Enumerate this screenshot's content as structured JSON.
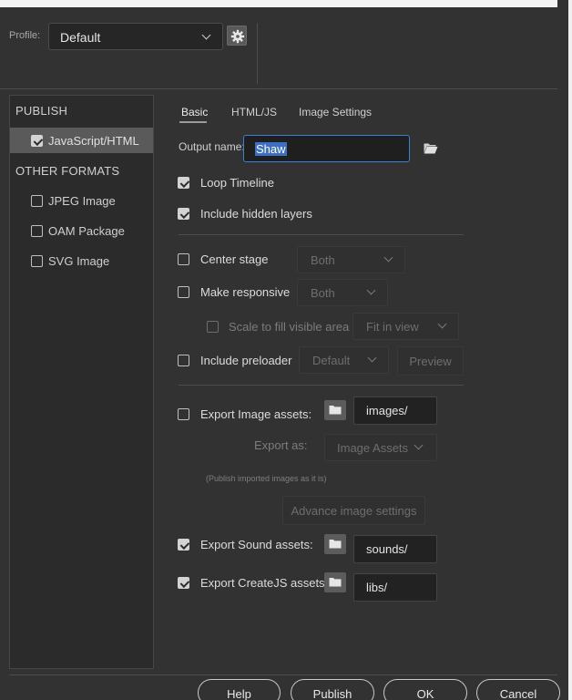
{
  "header": {
    "profile_label": "Profile:",
    "profile_value": "Default"
  },
  "sidebar": {
    "publish_heading": "PUBLISH",
    "publish_items": [
      {
        "label": "JavaScript/HTML",
        "checked": true,
        "selected": true
      }
    ],
    "other_heading": "OTHER FORMATS",
    "other_items": [
      {
        "label": "JPEG Image",
        "checked": false
      },
      {
        "label": "OAM Package",
        "checked": false
      },
      {
        "label": "SVG Image",
        "checked": false
      }
    ]
  },
  "tabs": [
    "Basic",
    "HTML/JS",
    "Image Settings"
  ],
  "active_tab": "Basic",
  "basic": {
    "output_name_label": "Output name:",
    "output_name_value": "Shaw",
    "loop_timeline": {
      "label": "Loop Timeline",
      "checked": true
    },
    "include_hidden_layers": {
      "label": "Include hidden layers",
      "checked": true
    },
    "center_stage": {
      "label": "Center stage",
      "checked": false,
      "dropdown": "Both"
    },
    "make_responsive": {
      "label": "Make responsive",
      "checked": false,
      "dropdown": "Both"
    },
    "scale_to_fill": {
      "label": "Scale to fill visible area",
      "checked": false,
      "dropdown": "Fit in view"
    },
    "include_preloader": {
      "label": "Include preloader",
      "checked": false,
      "dropdown": "Default",
      "preview_label": "Preview"
    },
    "export_image_assets": {
      "label": "Export Image assets:",
      "checked": false,
      "path": "images/"
    },
    "export_as": {
      "label": "Export as:",
      "value": "Image Assets"
    },
    "publish_hint": "(Publish imported images as it is)",
    "advance_image_settings_label": "Advance image settings",
    "export_sound_assets": {
      "label": "Export Sound assets:",
      "checked": true,
      "path": "sounds/"
    },
    "export_createjs_assets": {
      "label": "Export CreateJS assets:",
      "checked": true,
      "path": "libs/"
    }
  },
  "footer": {
    "help": "Help",
    "publish": "Publish",
    "ok": "OK",
    "cancel": "Cancel"
  },
  "colors": {
    "background": "#323232",
    "focus_border": "#3e7dcf",
    "selection": "#3d6fc2"
  }
}
